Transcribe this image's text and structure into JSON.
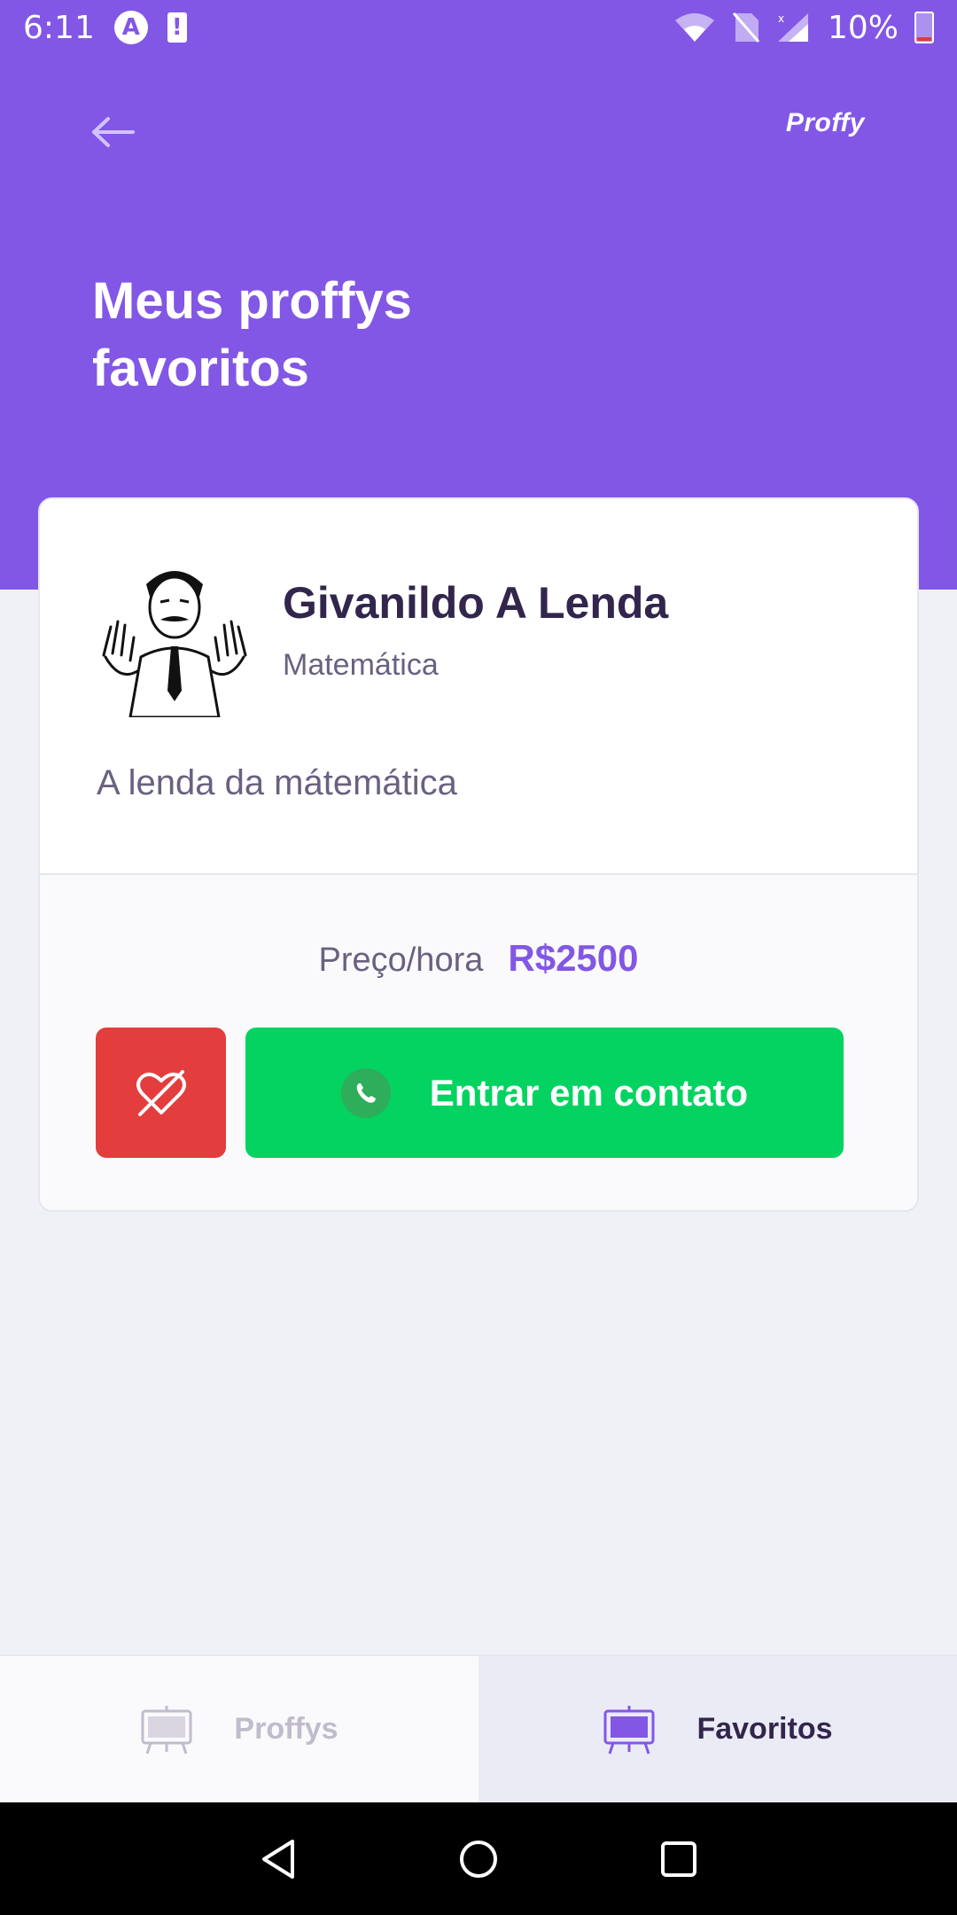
{
  "status_bar": {
    "time": "6:11",
    "app_badge": "A",
    "alert": "!",
    "battery": "10%"
  },
  "header": {
    "brand": "Proffy",
    "title_line1": "Meus proffys",
    "title_line2": "favoritos"
  },
  "teacher": {
    "name": "Givanildo A Lenda",
    "subject": "Matemática",
    "bio": "A lenda da mátemática",
    "price_label": "Preço/hora",
    "price_value": "R$2500",
    "contact_label": "Entrar em contato"
  },
  "tabs": [
    {
      "label": "Proffys",
      "active": false
    },
    {
      "label": "Favoritos",
      "active": true
    }
  ],
  "colors": {
    "primary": "#8257E5",
    "danger": "#E33D3D",
    "success": "#04D361",
    "title_text": "#32264D",
    "muted_text": "#6A6180"
  }
}
